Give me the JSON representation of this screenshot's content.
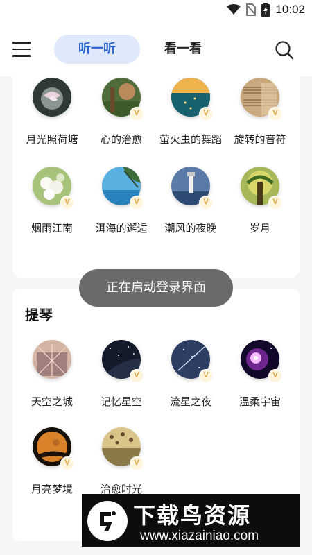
{
  "status_bar": {
    "time": "10:02"
  },
  "header": {
    "tabs": [
      {
        "label": "听一听",
        "active": true
      },
      {
        "label": "看一看",
        "active": false
      }
    ]
  },
  "section1": {
    "items": [
      {
        "label": "月光照荷塘",
        "vip": false
      },
      {
        "label": "心的治愈",
        "vip": true
      },
      {
        "label": "萤火虫的舞蹈",
        "vip": true
      },
      {
        "label": "旋转的音符",
        "vip": true
      },
      {
        "label": "烟雨江南",
        "vip": true
      },
      {
        "label": "洱海的邂逅",
        "vip": true
      },
      {
        "label": "潮风的夜晚",
        "vip": true
      },
      {
        "label": "岁月",
        "vip": true
      }
    ]
  },
  "section2": {
    "title": "提琴",
    "items": [
      {
        "label": "天空之城",
        "vip": false
      },
      {
        "label": "记忆星空",
        "vip": true
      },
      {
        "label": "流星之夜",
        "vip": true
      },
      {
        "label": "温柔宇宙",
        "vip": true
      },
      {
        "label": "月亮梦境",
        "vip": true
      },
      {
        "label": "治愈时光",
        "vip": true
      }
    ]
  },
  "vip_badge": "V",
  "toast": "正在启动登录界面",
  "watermark": {
    "title": "下载鸟资源",
    "url": "www.xiazainiao.com"
  }
}
